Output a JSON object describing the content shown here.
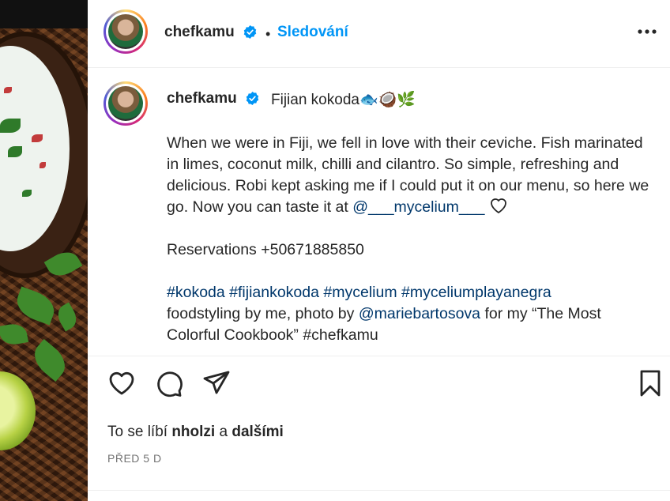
{
  "post": {
    "username": "chefkamu",
    "follow_dot": "•",
    "follow_label": "Sledování",
    "more_icon": "more-horizontal-icon"
  },
  "caption": {
    "username": "chefkamu",
    "title": "Fijian kokoda🐟🥥🌿",
    "paragraph1": "When we were in Fiji, we fell in love with their ceviche. Fish marinated in limes, coconut milk, chilli and cilantro. So simple, refreshing and delicious. Robi kept asking me if I could put it on our menu, so here we go. Now you can taste it at",
    "mention1": "@___mycelium___",
    "reservations": "Reservations +50671885850",
    "hashtags": "#kokoda #fijiankokoda #mycelium #myceliumplayanegra",
    "credits_prefix": "foodstyling by me, photo by",
    "mention2": "@mariebartosova",
    "credits_suffix": "for my “The Most",
    "credits_cut": "Colorful Cookbook” #chefkamu"
  },
  "likes": {
    "prefix": "To se líbí",
    "user": "nholzi",
    "and": "a",
    "others": "dalšími"
  },
  "time": "PŘED 5 D",
  "colors": {
    "accent": "#0095f6",
    "link": "#00376b",
    "text": "#262626",
    "muted": "#737373"
  }
}
